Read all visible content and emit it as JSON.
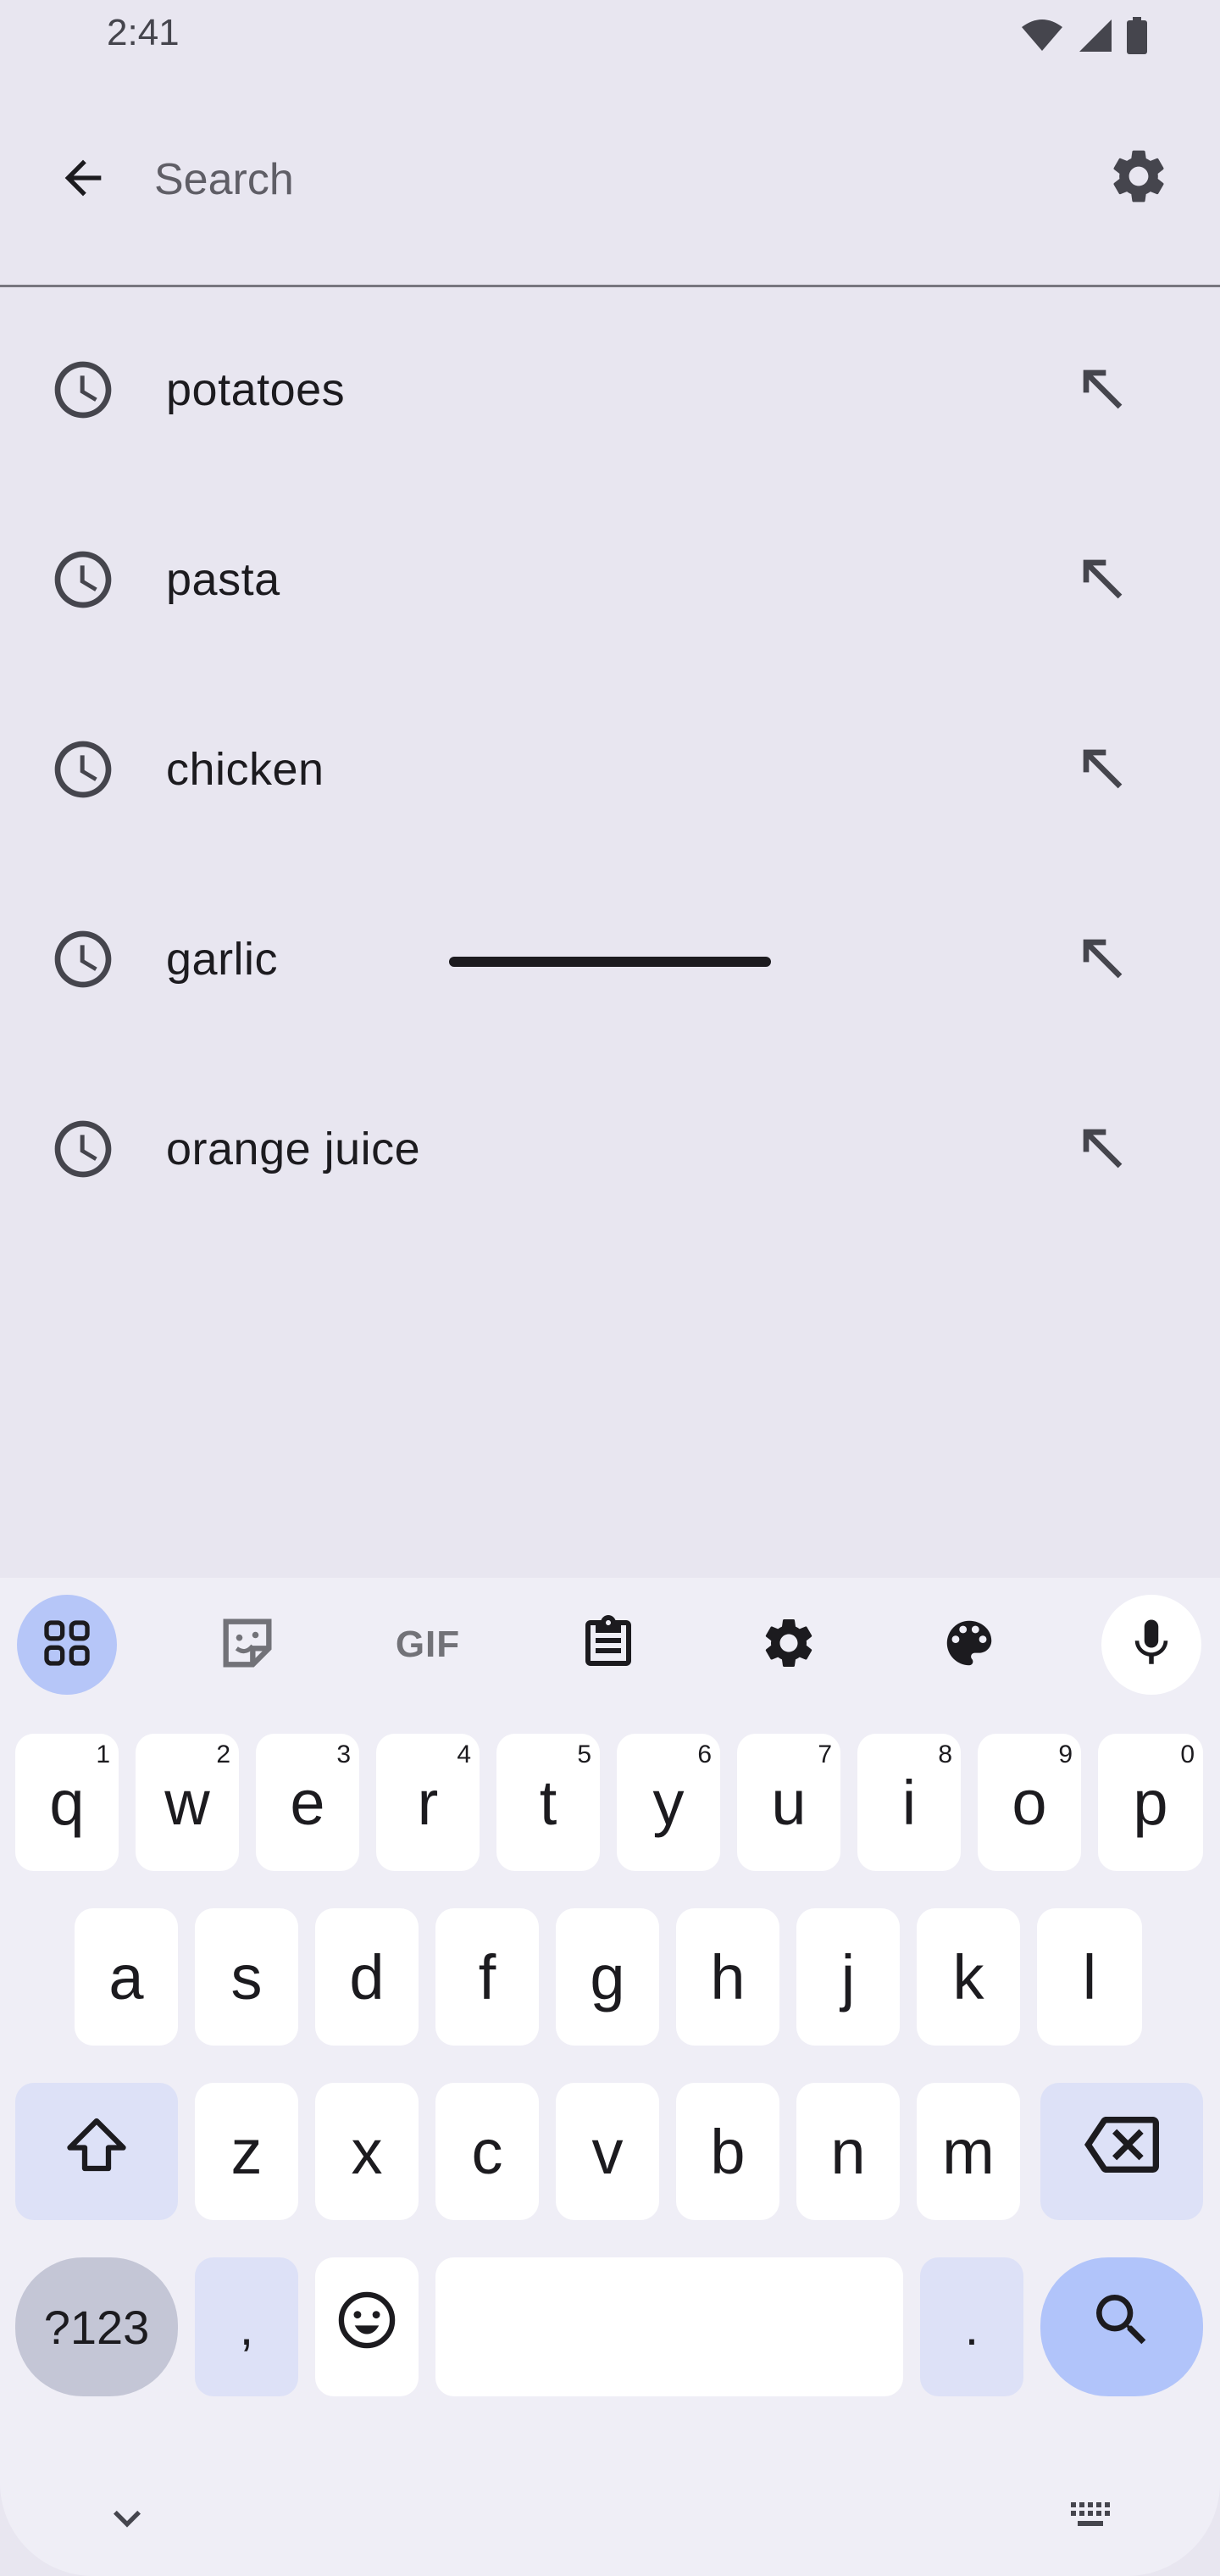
{
  "status_bar": {
    "time": "2:41",
    "icons": [
      "wifi-icon",
      "cellular-signal-icon",
      "battery-icon"
    ]
  },
  "search": {
    "placeholder": "Search",
    "value": "",
    "back_icon": "arrow-back-icon",
    "settings_icon": "gear-icon"
  },
  "suggestions": [
    {
      "label": "potatoes",
      "leading_icon": "history-clock-icon",
      "trailing_icon": "fill-query-arrow-icon"
    },
    {
      "label": "pasta",
      "leading_icon": "history-clock-icon",
      "trailing_icon": "fill-query-arrow-icon"
    },
    {
      "label": "chicken",
      "leading_icon": "history-clock-icon",
      "trailing_icon": "fill-query-arrow-icon"
    },
    {
      "label": "garlic",
      "leading_icon": "history-clock-icon",
      "trailing_icon": "fill-query-arrow-icon"
    },
    {
      "label": "orange juice",
      "leading_icon": "history-clock-icon",
      "trailing_icon": "fill-query-arrow-icon"
    }
  ],
  "keyboard": {
    "toolbar": [
      "apps-grid-icon",
      "sticker-icon",
      "gif-icon",
      "clipboard-icon",
      "gear-icon",
      "palette-icon",
      "microphone-icon"
    ],
    "gif_label": "GIF",
    "row1": [
      {
        "key": "q",
        "hint": "1"
      },
      {
        "key": "w",
        "hint": "2"
      },
      {
        "key": "e",
        "hint": "3"
      },
      {
        "key": "r",
        "hint": "4"
      },
      {
        "key": "t",
        "hint": "5"
      },
      {
        "key": "y",
        "hint": "6"
      },
      {
        "key": "u",
        "hint": "7"
      },
      {
        "key": "i",
        "hint": "8"
      },
      {
        "key": "o",
        "hint": "9"
      },
      {
        "key": "p",
        "hint": "0"
      }
    ],
    "row2": [
      "a",
      "s",
      "d",
      "f",
      "g",
      "h",
      "j",
      "k",
      "l"
    ],
    "row3": [
      "z",
      "x",
      "c",
      "v",
      "b",
      "n",
      "m"
    ],
    "symbols_label": "?123",
    "comma_label": ",",
    "period_label": ".",
    "accent_color": "#b1c4fa"
  }
}
